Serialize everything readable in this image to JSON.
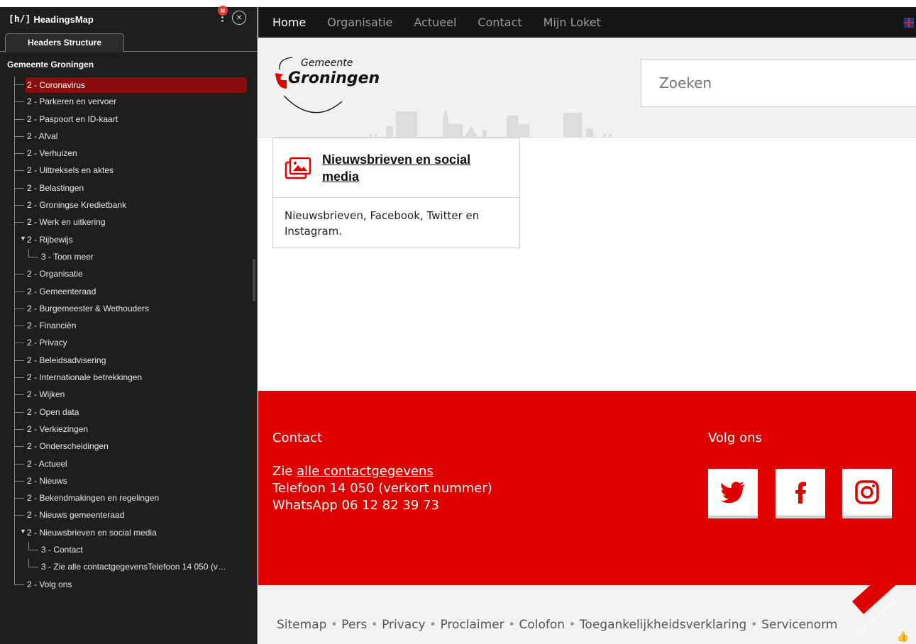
{
  "headingsmap": {
    "logo": "[h/]",
    "title": "HeadingsMap",
    "notification_badge": "N",
    "close_icon": "close-icon",
    "tab_label": "Headers Structure",
    "root_label": "Gemeente Groningen",
    "items": [
      {
        "label": "2 - Coronavirus",
        "level": 2,
        "selected": true
      },
      {
        "label": "2 - Parkeren en vervoer",
        "level": 2
      },
      {
        "label": "2 - Paspoort en ID-kaart",
        "level": 2
      },
      {
        "label": "2 - Afval",
        "level": 2
      },
      {
        "label": "2 - Verhuizen",
        "level": 2
      },
      {
        "label": "2 - Uittreksels en aktes",
        "level": 2
      },
      {
        "label": "2 - Belastingen",
        "level": 2
      },
      {
        "label": "2 - Groningse Kredietbank",
        "level": 2
      },
      {
        "label": "2 - Werk en uitkering",
        "level": 2
      },
      {
        "label": "2 - Rijbewijs",
        "level": 2,
        "expanded": true
      },
      {
        "label": "3 - Toon meer",
        "level": 3
      },
      {
        "label": "2 - Organisatie",
        "level": 2
      },
      {
        "label": "2 - Gemeenteraad",
        "level": 2
      },
      {
        "label": "2 - Burgemeester & Wethouders",
        "level": 2
      },
      {
        "label": "2 - Financiën",
        "level": 2
      },
      {
        "label": "2 - Privacy",
        "level": 2
      },
      {
        "label": "2 - Beleidsadvisering",
        "level": 2
      },
      {
        "label": "2 - Internationale betrekkingen",
        "level": 2
      },
      {
        "label": "2 - Wijken",
        "level": 2
      },
      {
        "label": "2 - Open data",
        "level": 2
      },
      {
        "label": "2 - Verkiezingen",
        "level": 2
      },
      {
        "label": "2 - Onderscheidingen",
        "level": 2
      },
      {
        "label": "2 - Actueel",
        "level": 2
      },
      {
        "label": "2 - Nieuws",
        "level": 2
      },
      {
        "label": "2 - Bekendmakingen en regelingen",
        "level": 2
      },
      {
        "label": "2 - Nieuws gemeenteraad",
        "level": 2
      },
      {
        "label": "2 - Nieuwsbrieven en social media",
        "level": 2,
        "expanded": true
      },
      {
        "label": "3 - Contact",
        "level": 3
      },
      {
        "label": "3 - Zie alle contactgegevensTelefoon 14 050 (v…",
        "level": 3
      },
      {
        "label": "2 - Volg ons",
        "level": 2
      }
    ]
  },
  "site": {
    "nav": [
      "Home",
      "Organisatie",
      "Actueel",
      "Contact",
      "Mijn Loket"
    ],
    "active_nav": "Home",
    "language_flag": "uk-flag-icon",
    "logo_text_top": "Gemeente",
    "logo_text_main": "Groningen",
    "search_placeholder": "Zoeken",
    "card": {
      "title": "Nieuwsbrieven en social media",
      "description": "Nieuwsbrieven, Facebook, Twitter en Instagram.",
      "icon": "image-gallery-icon"
    },
    "footer": {
      "contact_heading": "Contact",
      "contact_prefix": "Zie ",
      "contact_link": "alle contactgegevens",
      "phone": "Telefoon 14 050 (verkort nummer)",
      "whatsapp": "WhatsApp  06 12 82 39 73",
      "follow_heading": "Volg ons",
      "social": [
        "twitter-icon",
        "facebook-icon",
        "instagram-icon"
      ]
    },
    "bottom_links": [
      "Sitemap",
      "Pers",
      "Privacy",
      "Proclaimer",
      "Colofon",
      "Toegankelijkheidsverklaring",
      "Servicenorm"
    ],
    "feedback": "Geef uw mening",
    "colors": {
      "brand_red": "#e00000",
      "nav_bg": "#161616",
      "panel_bg": "#1e1e1e",
      "selected": "#8a0d0d"
    }
  }
}
